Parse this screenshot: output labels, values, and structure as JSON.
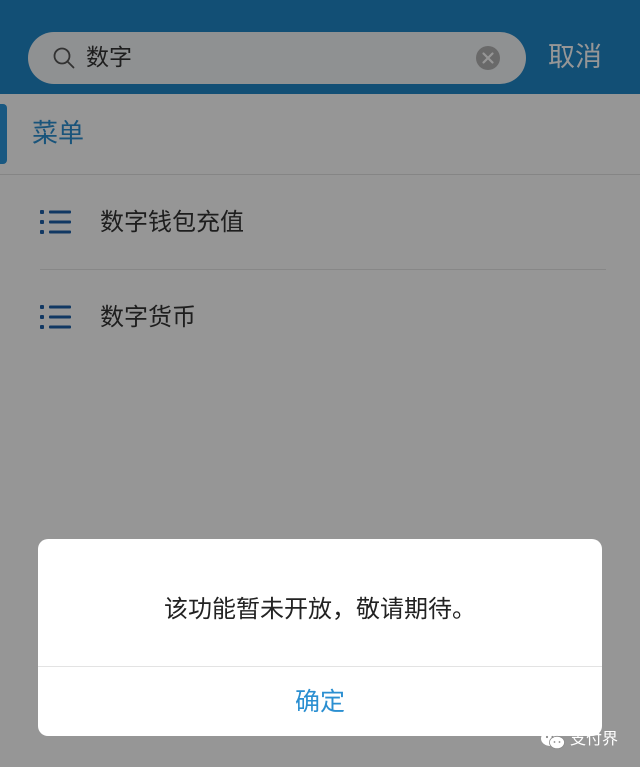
{
  "search": {
    "query": "数字",
    "cancel_label": "取消"
  },
  "results": {
    "section_title": "菜单",
    "items": [
      {
        "label": "数字钱包充值",
        "icon": "list-icon"
      },
      {
        "label": "数字货币",
        "icon": "list-icon"
      }
    ]
  },
  "dialog": {
    "message": "该功能暂未开放，敬请期待。",
    "confirm_label": "确定"
  },
  "watermark": {
    "text": "支付界"
  },
  "colors": {
    "header": "#1f86c8",
    "accent": "#2b8fd1",
    "icon": "#1d5fa8"
  }
}
